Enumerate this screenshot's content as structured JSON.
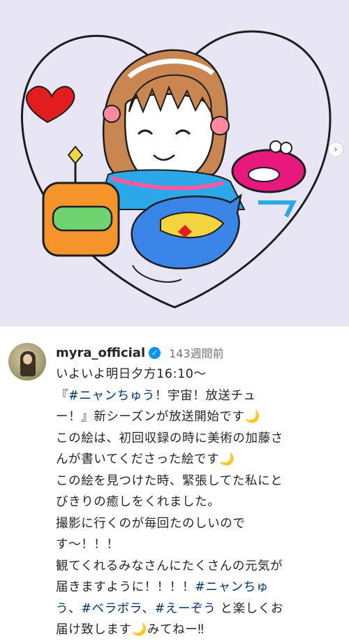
{
  "post": {
    "next_icon": "chevron-right-icon",
    "illustration_colors": {
      "background": "#e8e6f4",
      "hair": "#c98650",
      "robot": "#f5942b",
      "visor": "#6fd46f",
      "heart": "#e11d1d",
      "lips": "#e8197e",
      "cat": "#3a86e8"
    }
  },
  "caption": {
    "username": "myra_official",
    "verified_icon": "verified-badge-icon",
    "timestamp": "143週間前",
    "lines": [
      [
        {
          "t": "いよいよ明日夕方16:10〜"
        }
      ],
      [
        {
          "t": "『"
        },
        {
          "t": "#ニャンちゅう",
          "tag": true
        },
        {
          "t": "！宇宙！放送チュ"
        }
      ],
      [
        {
          "t": "ー！』新シーズンが放送開始です🌙"
        }
      ],
      [
        {
          "t": "この絵は、初回収録の時に美術の加藤さ"
        }
      ],
      [
        {
          "t": "んが書いてくださった絵です🌙"
        }
      ],
      [
        {
          "t": "この絵を見つけた時、緊張してた私にと"
        }
      ],
      [
        {
          "t": "びきりの癒しをくれました。"
        }
      ],
      [
        {
          "t": "撮影に行くのが毎回たのしいので"
        }
      ],
      [
        {
          "t": "す〜！！！"
        }
      ],
      [
        {
          "t": "観てくれるみなさんにたくさんの元気が"
        }
      ],
      [
        {
          "t": "届きますように！！！！"
        },
        {
          "t": "#ニャンちゅ",
          "tag": true
        }
      ],
      [
        {
          "t": "う",
          "tag": true
        },
        {
          "t": "、"
        },
        {
          "t": "#ベラボラ",
          "tag": true
        },
        {
          "t": "、"
        },
        {
          "t": "#えーぞう",
          "tag": true
        },
        {
          "t": " と楽しくお"
        }
      ],
      [
        {
          "t": "届け致します🌙みてねー‼︎"
        }
      ]
    ]
  }
}
